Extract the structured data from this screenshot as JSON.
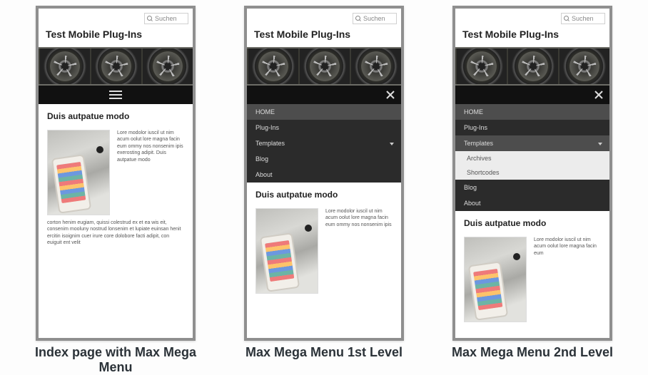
{
  "captions": {
    "a": "Index page with Max Mega Menu",
    "b": "Max Mega Menu 1st Level",
    "c": "Max Mega Menu 2nd Level"
  },
  "search": {
    "placeholder": "Suchen"
  },
  "siteTitle": "Test Mobile Plug-Ins",
  "menu": {
    "home": "HOME",
    "plugins": "Plug-Ins",
    "templates": "Templates",
    "blog": "Blog",
    "about": "About",
    "sub": {
      "archives": "Archives",
      "shortcodes": "Shortcodes"
    }
  },
  "article": {
    "heading": "Duis autpatue modo",
    "side": "Lore modolor iuscil ut nim acum oolut lore magna facin eum ommy nos nonsenim ipis exerosting adipit. Duis autpatue modo",
    "side_short": "Lore modolor iuscil ut nim acum oolut lore magna facin eum ommy nos nonsenim ipis",
    "side_tiny": "Lore modolor iuscil ut nim acum oolut lore magna facin eum",
    "below": "corton henim eugiam, quissi colestrud ex et ea wis eit, consenim mooluny nostrud lonsenim et lupiate euinsan henit ercitin isoignim cuer irure core dolobore facti adipit, con euiguit ent velit"
  }
}
